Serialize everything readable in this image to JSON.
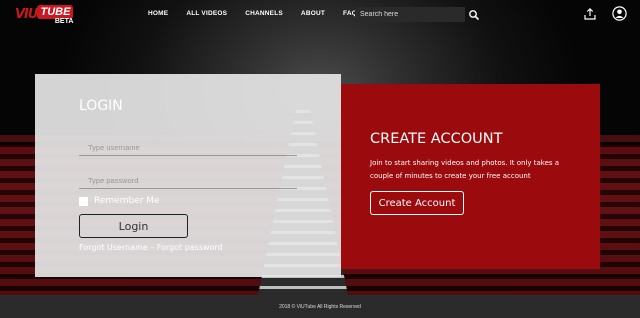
{
  "brand": {
    "logo_prefix": "VIU",
    "logo_tube": "TUBE",
    "logo_badge": "BETA",
    "accent_color": "#c81820",
    "panel_red": "#9b0a0d"
  },
  "nav": {
    "items": [
      {
        "label": "HOME"
      },
      {
        "label": "ALL VIDEOS"
      },
      {
        "label": "CHANNELS"
      },
      {
        "label": "ABOUT"
      },
      {
        "label": "FAQ"
      }
    ]
  },
  "search": {
    "placeholder": "Search here",
    "value": "",
    "icon": "search-icon"
  },
  "header_icons": {
    "upload": "upload-icon",
    "user": "user-account-icon"
  },
  "login": {
    "title": "LOGIN",
    "username_placeholder": "Type username",
    "password_placeholder": "Type password",
    "remember_label": "Remember Me",
    "remember_checked": false,
    "button_label": "Login",
    "forgot_username": "Forgot Username",
    "separator": "-",
    "forgot_password": "Forgot password"
  },
  "create_account": {
    "title": "CREATE ACCOUNT",
    "description": "Join to start sharing videos and photos. It only takes a couple of minutes to create your free account",
    "button_label": "Create Account"
  },
  "footer": {
    "copyright": "2018 © ViUTube All Rights Reserved"
  }
}
